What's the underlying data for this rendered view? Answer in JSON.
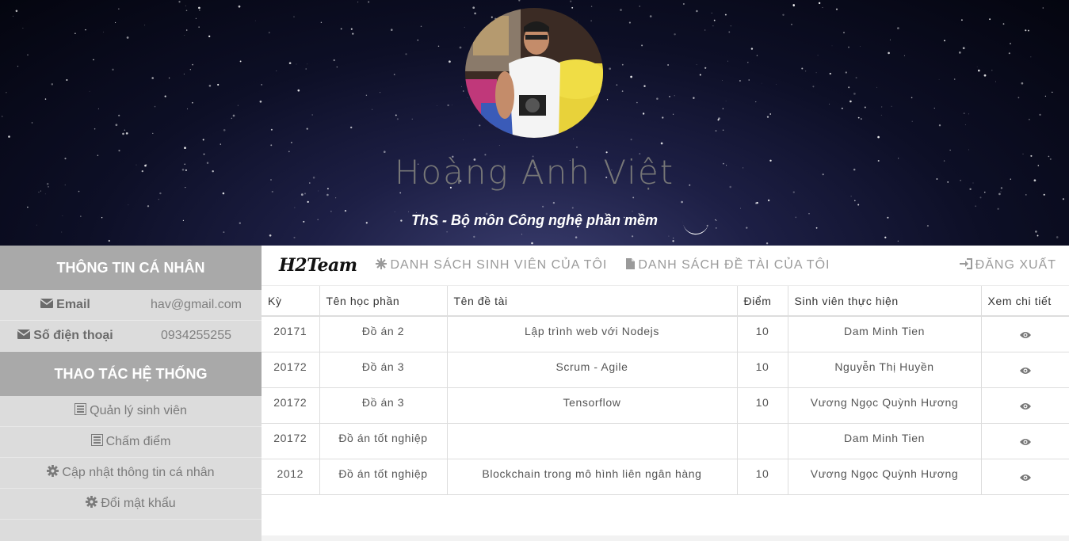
{
  "header": {
    "name": "Hoàng Anh Việt",
    "title": "ThS - Bộ môn Công nghệ phần mềm"
  },
  "sidebar": {
    "personal_heading": "THÔNG TIN CÁ NHÂN",
    "info": [
      {
        "label": "Email",
        "value": "hav@gmail.com",
        "icon": "envelope-icon"
      },
      {
        "label": "Số điện thoại",
        "value": "0934255255",
        "icon": "envelope-icon"
      }
    ],
    "system_heading": "THAO TÁC HỆ THỐNG",
    "menu": [
      {
        "label": "Quản lý sinh viên",
        "icon": "list-icon"
      },
      {
        "label": "Chấm điểm",
        "icon": "list-icon"
      },
      {
        "label": "Cập nhật thông tin cá nhân",
        "icon": "gear-icon"
      },
      {
        "label": "Đổi mật khẩu",
        "icon": "gear-icon"
      }
    ]
  },
  "nav": {
    "brand": "H2Team",
    "students_link": "DANH SÁCH SINH VIÊN CỦA TÔI",
    "topics_link": "DANH SÁCH ĐỀ TÀI CỦA TÔI",
    "logout": "ĐĂNG XUẤT"
  },
  "table": {
    "headers": [
      "Kỳ",
      "Tên học phần",
      "Tên đề tài",
      "Điểm",
      "Sinh viên thực hiện",
      "Xem chi tiết"
    ],
    "rows": [
      {
        "term": "20171",
        "course": "Đồ án 2",
        "topic": "Lập trình web với Nodejs",
        "score": "10",
        "student": "Dam Minh Tien"
      },
      {
        "term": "20172",
        "course": "Đồ án 3",
        "topic": "Scrum - Agile",
        "score": "10",
        "student": "Nguyễn Thị Huyền"
      },
      {
        "term": "20172",
        "course": "Đồ án 3",
        "topic": "Tensorflow",
        "score": "10",
        "student": "Vương Ngọc Quỳnh Hương"
      },
      {
        "term": "20172",
        "course": "Đồ án tốt nghiệp",
        "topic": "",
        "score": "",
        "student": "Dam Minh Tien"
      },
      {
        "term": "2012",
        "course": "Đồ án tốt nghiệp",
        "topic": "Blockchain trong mô hình liên ngân hàng",
        "score": "10",
        "student": "Vương Ngọc Quỳnh Hương"
      }
    ]
  }
}
